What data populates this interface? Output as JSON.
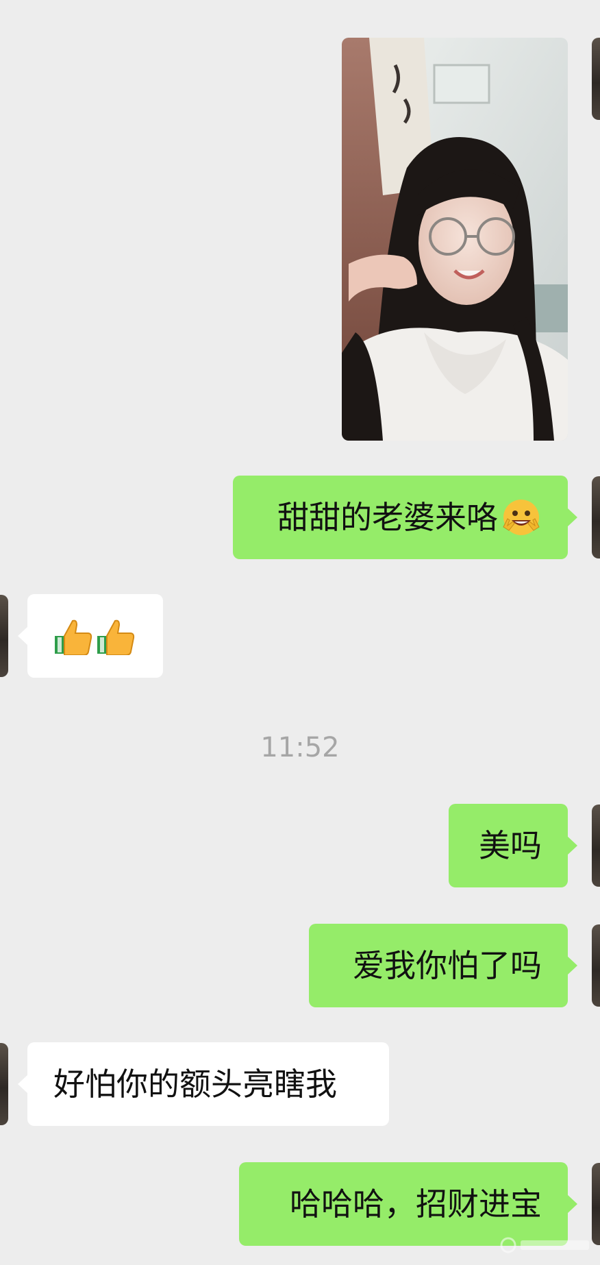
{
  "chat": {
    "timestamp": "11:52",
    "messages": [
      {
        "sender": "me",
        "type": "image",
        "icon": "selfie-photo"
      },
      {
        "sender": "me",
        "type": "text",
        "text": "甜甜的老婆来咯",
        "emoji": "grinning-peace-emoji"
      },
      {
        "sender": "them",
        "type": "emoji",
        "icons": [
          "thumbs-up-emoji",
          "thumbs-up-emoji"
        ]
      },
      {
        "sender": "me",
        "type": "text",
        "text": "美吗"
      },
      {
        "sender": "me",
        "type": "text",
        "text": "爱我你怕了吗"
      },
      {
        "sender": "them",
        "type": "text",
        "text": "好怕你的额头亮瞎我"
      },
      {
        "sender": "me",
        "type": "text",
        "text": "哈哈哈，招财进宝"
      }
    ]
  },
  "colors": {
    "background": "#ededed",
    "me_bubble": "#95ec69",
    "them_bubble": "#ffffff",
    "timestamp_text": "#a6a6a6"
  }
}
